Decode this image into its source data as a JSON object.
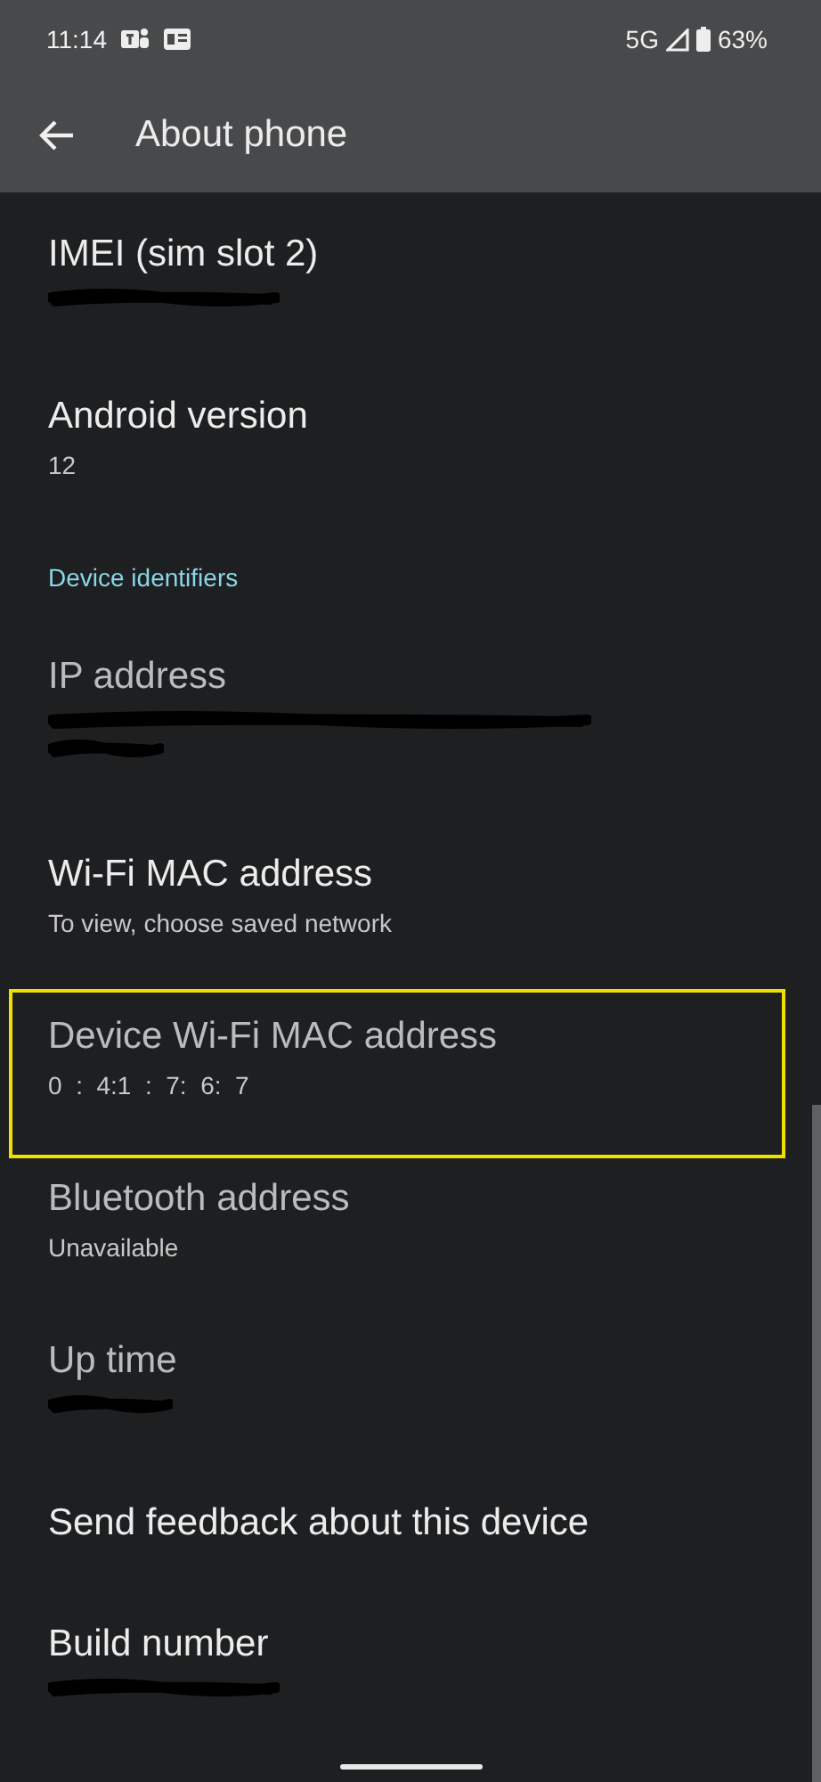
{
  "status_bar": {
    "time": "11:14",
    "network": "5G",
    "battery": "63%"
  },
  "app_bar": {
    "title": "About phone"
  },
  "items": [
    {
      "kind": "preference",
      "title": "IMEI (sim slot 2)",
      "dimmed": false,
      "redaction": {
        "kind": "short"
      }
    },
    {
      "kind": "preference",
      "title": "Android version",
      "dimmed": false,
      "summary": "12"
    },
    {
      "kind": "category",
      "title": "Device identifiers"
    },
    {
      "kind": "preference",
      "title": "IP address",
      "dimmed": true,
      "redaction": {
        "kind": "two-line"
      }
    },
    {
      "kind": "preference",
      "title": "Wi-Fi MAC address",
      "dimmed": false,
      "summary": "To view, choose saved network"
    },
    {
      "kind": "preference",
      "title": "Device Wi-Fi MAC address",
      "dimmed": true,
      "summary": "0  :  4:1  :  7:  6:  7",
      "highlighted": true
    },
    {
      "kind": "preference",
      "title": "Bluetooth address",
      "dimmed": true,
      "summary": "Unavailable"
    },
    {
      "kind": "preference",
      "title": "Up time",
      "dimmed": true,
      "redaction": {
        "kind": "tiny"
      }
    },
    {
      "kind": "preference",
      "title": "Send feedback about this device",
      "dimmed": false
    },
    {
      "kind": "preference",
      "title": "Build number",
      "dimmed": false,
      "redaction": {
        "kind": "short"
      }
    }
  ]
}
